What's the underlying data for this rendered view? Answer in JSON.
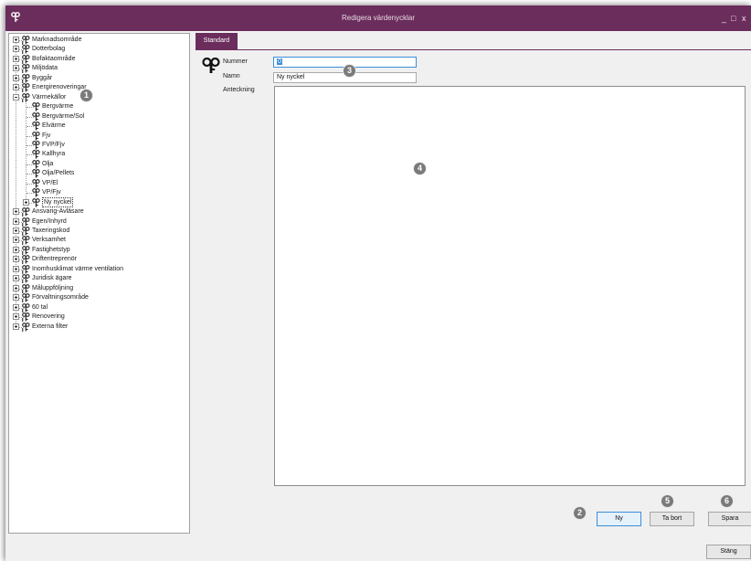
{
  "window": {
    "title": "Redigera värdenycklar",
    "controls": [
      "_",
      "□",
      "x"
    ]
  },
  "colors": {
    "titlebar": "#6b2d5c",
    "tab_active": "#6b2d5c",
    "focus_border": "#3b8ed8"
  },
  "tree": {
    "items": [
      {
        "label": "Marknadsområde",
        "level": 0,
        "expander": "plus",
        "icon": "key-group-icon"
      },
      {
        "label": "Dotterbolag",
        "level": 0,
        "expander": "plus",
        "icon": "key-group-icon"
      },
      {
        "label": "Bofaktaområde",
        "level": 0,
        "expander": "plus",
        "icon": "key-group-icon"
      },
      {
        "label": "Miljödata",
        "level": 0,
        "expander": "plus",
        "icon": "key-group-icon"
      },
      {
        "label": "Byggår",
        "level": 0,
        "expander": "plus",
        "icon": "key-group-icon"
      },
      {
        "label": "Energirenoveringar",
        "level": 0,
        "expander": "plus",
        "icon": "key-group-icon"
      },
      {
        "label": "Värmekällor",
        "level": 0,
        "expander": "minus",
        "icon": "key-group-icon"
      },
      {
        "label": "Bergvärme",
        "level": 1,
        "expander": "",
        "icon": "key-icon"
      },
      {
        "label": "Bergvärme/Sol",
        "level": 1,
        "expander": "",
        "icon": "key-icon"
      },
      {
        "label": "Elvärme",
        "level": 1,
        "expander": "",
        "icon": "key-icon"
      },
      {
        "label": "Fjv",
        "level": 1,
        "expander": "",
        "icon": "key-icon"
      },
      {
        "label": "FVP/Fjv",
        "level": 1,
        "expander": "",
        "icon": "key-icon"
      },
      {
        "label": "Kallhyra",
        "level": 1,
        "expander": "",
        "icon": "key-icon"
      },
      {
        "label": "Olja",
        "level": 1,
        "expander": "",
        "icon": "key-icon"
      },
      {
        "label": "Olja/Pellets",
        "level": 1,
        "expander": "",
        "icon": "key-icon"
      },
      {
        "label": "VP/El",
        "level": 1,
        "expander": "",
        "icon": "key-icon"
      },
      {
        "label": "VP/Fjv",
        "level": 1,
        "expander": "",
        "icon": "key-icon"
      },
      {
        "label": "Ny nyckel",
        "level": 1,
        "expander": "plus",
        "icon": "key-icon",
        "selected": true
      },
      {
        "label": "Ansvarig-Avläsare",
        "level": 0,
        "expander": "plus",
        "icon": "key-group-icon"
      },
      {
        "label": "Egen/Inhyrd",
        "level": 0,
        "expander": "plus",
        "icon": "key-group-icon"
      },
      {
        "label": "Taxeringskod",
        "level": 0,
        "expander": "plus",
        "icon": "key-group-icon"
      },
      {
        "label": "Verksamhet",
        "level": 0,
        "expander": "plus",
        "icon": "key-group-icon"
      },
      {
        "label": "Fastighetstyp",
        "level": 0,
        "expander": "plus",
        "icon": "key-group-icon"
      },
      {
        "label": "Driftentreprenör",
        "level": 0,
        "expander": "plus",
        "icon": "key-group-icon"
      },
      {
        "label": "Inomhusklimat värme ventilation",
        "level": 0,
        "expander": "plus",
        "icon": "key-group-icon"
      },
      {
        "label": "Juridisk ägare",
        "level": 0,
        "expander": "plus",
        "icon": "key-group-icon"
      },
      {
        "label": "Måluppföljning",
        "level": 0,
        "expander": "plus",
        "icon": "key-group-icon"
      },
      {
        "label": "Förvaltningsområde",
        "level": 0,
        "expander": "plus",
        "icon": "key-group-icon"
      },
      {
        "label": "60 tal",
        "level": 0,
        "expander": "plus",
        "icon": "key-group-icon"
      },
      {
        "label": "Renovering",
        "level": 0,
        "expander": "plus",
        "icon": "key-group-icon"
      },
      {
        "label": "Externa filter",
        "level": 0,
        "expander": "plus",
        "icon": "key-group-icon"
      }
    ]
  },
  "tabs": [
    {
      "label": "Standard",
      "active": true
    }
  ],
  "form": {
    "nummer_label": "Nummer",
    "nummer_value": "0",
    "namn_label": "Namn",
    "namn_value": "Ny nyckel",
    "anteckning_label": "Anteckning",
    "anteckning_value": ""
  },
  "buttons": {
    "ny": "Ny",
    "ta_bort": "Ta bort",
    "spara": "Spara",
    "stang": "Stäng"
  },
  "callouts": [
    "1",
    "2",
    "3",
    "4",
    "5",
    "6"
  ]
}
